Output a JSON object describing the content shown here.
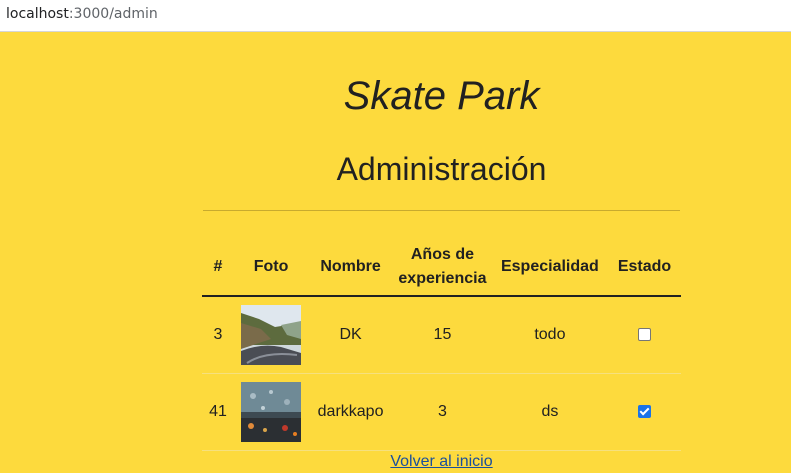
{
  "browser": {
    "url_host": "localhost",
    "url_rest": ":3000/admin"
  },
  "page": {
    "title": "Skate Park",
    "subtitle": "Administración",
    "back_link": "Volver al inicio"
  },
  "table": {
    "headers": {
      "id": "#",
      "photo": "Foto",
      "name": "Nombre",
      "experience_line1": "Años",
      "experience_line2": "de",
      "experience_line3": "experiencia",
      "specialty": "Especialidad",
      "status": "Estado"
    },
    "rows": [
      {
        "id": "3",
        "name": "DK",
        "experience": "15",
        "specialty": "todo",
        "status_checked": false
      },
      {
        "id": "41",
        "name": "darkkapo",
        "experience": "3",
        "specialty": "ds",
        "status_checked": true
      }
    ]
  },
  "colors": {
    "background": "#fdda3d",
    "link": "#1a4f9c",
    "checkbox_checked": "#1a73e8"
  }
}
